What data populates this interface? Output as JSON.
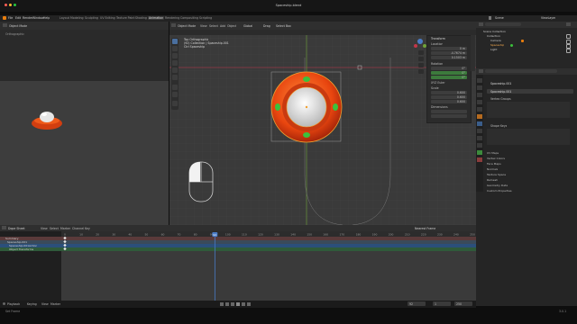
{
  "window": {
    "title": "Spaceship.blend"
  },
  "menu": [
    "File",
    "Edit",
    "Render",
    "Window",
    "Help"
  ],
  "workspaces": [
    "Layout",
    "Modeling",
    "Sculpting",
    "UV Editing",
    "Texture Paint",
    "Shading",
    "Animation",
    "Rendering",
    "Compositing",
    "Scripting"
  ],
  "active_workspace": "Animation",
  "scene": {
    "name": "Scene",
    "view_layer": "ViewLayer"
  },
  "left_panel": {
    "mode": "Object Mode",
    "view_label": "Orthographic"
  },
  "viewport": {
    "header": {
      "mode": "Object Mode",
      "view": "View",
      "select": "Select",
      "add": "Add",
      "object": "Object",
      "orientation": "Global",
      "snap": "Drag",
      "select_box": "Select Box"
    },
    "overlay_text": [
      "Top Orthographic",
      "(92) Collection | Spaceship.001",
      "Ctrl Spaceship"
    ],
    "npanel": {
      "title": "Transform",
      "location": "Location",
      "rotation": "Rotation",
      "scale": "Scale",
      "dimensions": "Dimensions",
      "location_values": [
        "0 m",
        "-4.7674 m",
        "0.1503 m"
      ],
      "rotation_values": [
        "0°",
        "0°",
        "0°"
      ],
      "scale_values": [
        "0.600",
        "0.600",
        "0.600"
      ],
      "mode": "XYZ Euler"
    }
  },
  "outliner": {
    "header": "Scene Collection",
    "items": [
      "Scene Collection",
      "Collection",
      "Camera",
      "Spaceship",
      "Light"
    ]
  },
  "properties": {
    "object_name": "Spaceship.001",
    "mesh_name": "Spaceship.001",
    "sections": [
      "Vertex Groups",
      "Shape Keys",
      "UV Maps",
      "Vertex Colors",
      "Face Maps",
      "Normals",
      "Texture Space",
      "Remesh",
      "Geometry Data",
      "Custom Properties"
    ]
  },
  "timeline": {
    "header": {
      "mode": "Dope Sheet",
      "view": "View",
      "select": "Select",
      "marker": "Marker",
      "channel": "Channel",
      "key": "Key",
      "interp": "Nearest Frame"
    },
    "current_frame": 92,
    "ruler": [
      0,
      10,
      20,
      30,
      40,
      50,
      60,
      70,
      80,
      90,
      100,
      110,
      120,
      130,
      140,
      150,
      160,
      170,
      180,
      190,
      200,
      210,
      220,
      230,
      240,
      250
    ],
    "channels": [
      "Summary",
      "Spaceship.001",
      "Spaceship.001Action",
      "Object Transforms"
    ]
  },
  "status": {
    "playback": "Playback",
    "keying": "Keying",
    "view": "View",
    "marker": "Marker",
    "start": "1",
    "end": "250",
    "left_text": "Set Frame",
    "right_text": "3.0.1"
  },
  "colors": {
    "accent": "#4a7cc7",
    "ufo_red": "#e8450f",
    "ufo_green": "#3cc13c",
    "selection_orange": "#f0a030",
    "xaxis": "#c2374a",
    "yaxis": "#6fa33a"
  }
}
